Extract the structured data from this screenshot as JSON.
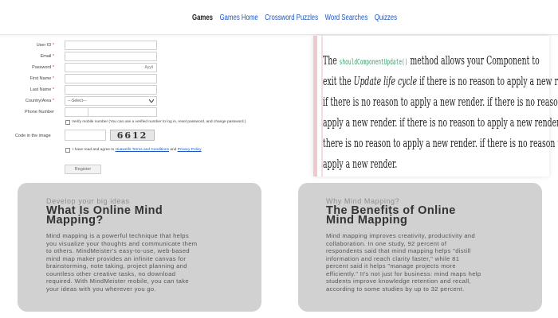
{
  "nav": {
    "items": [
      "Games",
      "Games Home",
      "Crossword Puzzles",
      "Word Searches",
      "Quizzes"
    ]
  },
  "form": {
    "fields": [
      {
        "label": "User ID",
        "required": "*",
        "value": "",
        "hint": ""
      },
      {
        "label": "Email",
        "required": "*",
        "value": "",
        "hint": ""
      },
      {
        "label": "Password",
        "required": "*",
        "value": "",
        "hint": "Ayyil"
      },
      {
        "label": "First Name",
        "required": "*",
        "value": "",
        "hint": ""
      },
      {
        "label": "Last Name",
        "required": "*",
        "value": "",
        "hint": ""
      },
      {
        "label": "Country/Area",
        "required": "*",
        "value": "---Select---",
        "hint": ""
      },
      {
        "label": "Phone Number",
        "required": "",
        "value": "",
        "hint": ""
      }
    ],
    "verify_text": "Verify mobile number (You can use a verified number to log in, reset password, and change password.)",
    "captcha_label": "Code in the image",
    "captcha_code": "6612",
    "agree_prefix": "I have read and agree to",
    "terms_link": "Huaweifs Terms and Conditions",
    "agree_and": "and",
    "privacy_link": "Privacy Policy",
    "register_label": "Register"
  },
  "code_card": {
    "line1_pre": "The",
    "method": "shouldComponentUpdate()",
    "line1_post": "method allows your Component to",
    "line2_pre": "exit the",
    "line2_em": "Update life cycle",
    "line2_post": "if there is no reason to apply a new render.",
    "line3": "if there is no reason to apply a new render. if there is no reason to",
    "line4": "apply a new render. if there is no reason to apply a new render. if",
    "line5": "there is no reason to apply a new render. if there is no reason to",
    "line6": "apply a new render."
  },
  "card_left": {
    "subtitle": "Develop your big ideas",
    "title_line1": "What Is Online Mind",
    "title_line2": "Mapping?",
    "body": [
      "Mind mapping is a powerful technique that helps",
      "you visualize your thoughts and communicate them",
      "to others. MindMeister's easy-to-use, web-based",
      "mind map maker provides an infinite canvas for",
      "brainstorming, note taking, project planning and",
      "countless other creative tasks, no download",
      "required. With MindMeister mobile, you can take",
      "your ideas with you wherever you go."
    ]
  },
  "card_right": {
    "subtitle": "Why Mind Mapping?",
    "title_line1": "The Benefits of Online",
    "title_line2": "Mind Mapping",
    "body": [
      "Mind mapping improves creativity, productivity and",
      "collaboration. In one study, 92 percent of",
      "respondents said that mind mapping helps \"distill",
      "information and reach clarity faster,\" while 81",
      "percent said it helps \"manage projects more",
      "efficiently.\" It's not just for business: mind maps help",
      "students improve knowledge retention and recall,",
      "according to some studies by up to 32 percent."
    ]
  }
}
